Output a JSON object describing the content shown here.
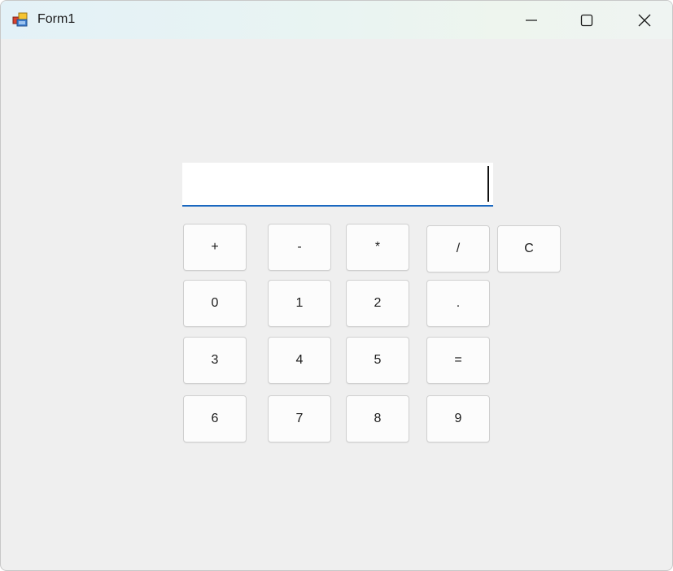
{
  "window": {
    "title": "Form1",
    "icon": "winforms-app-icon",
    "controls": [
      "minimize-icon",
      "maximize-icon",
      "close-icon"
    ]
  },
  "display": {
    "value": ""
  },
  "buttons": {
    "plus": "+",
    "minus": "-",
    "multiply": "*",
    "divide": "/",
    "clear": "C",
    "d0": "0",
    "d1": "1",
    "d2": "2",
    "dot": ".",
    "d3": "3",
    "d4": "4",
    "d5": "5",
    "equals": "=",
    "d6": "6",
    "d7": "7",
    "d8": "8",
    "d9": "9"
  },
  "colors": {
    "focus_underline": "#1a68c0",
    "form_background": "#efefef"
  }
}
